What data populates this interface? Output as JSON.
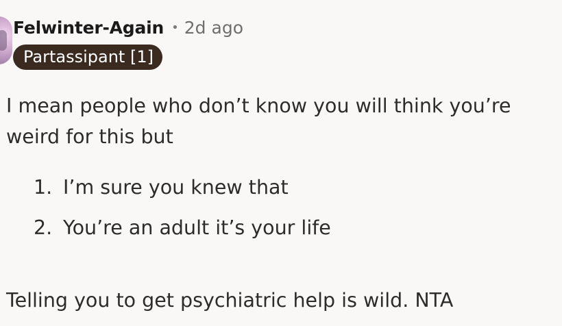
{
  "comment": {
    "author": "Felwinter-Again",
    "separator": "•",
    "time": "2d ago",
    "flair": "Partassipant [1]",
    "paragraph1": "I mean people who don’t know you will think you’re weird for this but",
    "list": [
      {
        "marker": "1.",
        "text": "I’m sure you knew that"
      },
      {
        "marker": "2.",
        "text": "You’re an adult it’s your life"
      }
    ],
    "paragraph2": "Telling you to get psychiatric help is wild. NTA"
  },
  "colors": {
    "background": "#faf8f6",
    "flair_background": "#3a2a20",
    "flair_text": "#ffffff",
    "meta_text": "#6e6e6e"
  },
  "icons": {
    "avatar": "user-avatar"
  }
}
